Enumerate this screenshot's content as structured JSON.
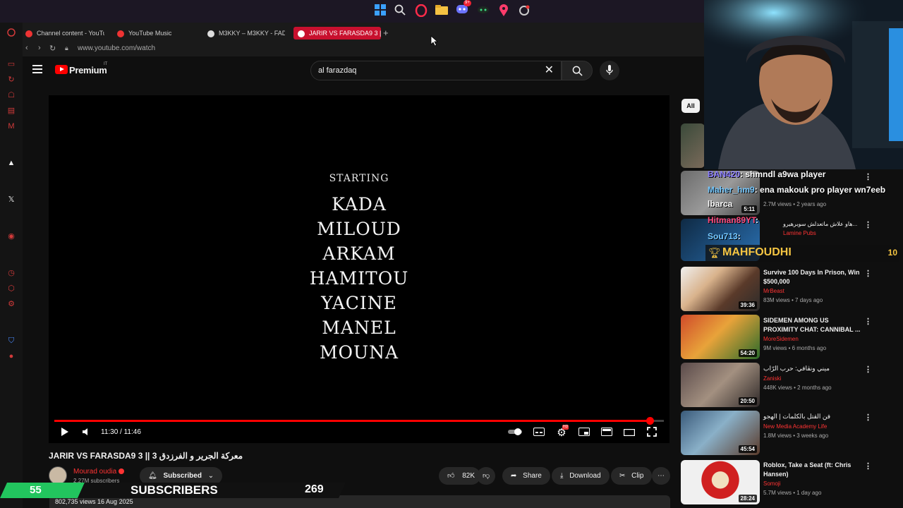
{
  "taskbar": {
    "icons": [
      "windows-start-icon",
      "search-icon",
      "opera-gx-icon",
      "file-explorer-icon",
      "discord-icon",
      "app-icon",
      "maps-icon",
      "settings-icon"
    ],
    "discord_badge": "9+"
  },
  "browser": {
    "tabs": [
      {
        "label": "Channel content - YouTu"
      },
      {
        "label": "YouTube Music"
      },
      {
        "label": "M3KKY – M3KKY - FADD"
      },
      {
        "label": "JARIR VS FARASDA9 3 ||"
      }
    ],
    "url": "www.youtube.com/watch"
  },
  "header": {
    "brand": "Premium",
    "country": "IT",
    "search_value": "al farazdaq"
  },
  "player": {
    "credits_heading": "STARTING",
    "credits_names": [
      "KADA",
      "MILOUD",
      "ARKAM",
      "HAMITOU",
      "YACINE",
      "MANEL",
      "MOUNA"
    ],
    "time": "11:30 / 11:46",
    "progress": 0.977,
    "settings_badge": "HD"
  },
  "video": {
    "title": "JARIR VS FARASDA9 3 || معركة الجرير و الفرزدق 3",
    "channel": "Mourad oudia",
    "subscribers": "2.27M subscribers",
    "subscribed_label": "Subscribed",
    "likes": "82K",
    "share_label": "Share",
    "download_label": "Download",
    "clip_label": "Clip",
    "views_date": "802,735 views  16 Aug 2025"
  },
  "sidebar": {
    "chip_all": "All",
    "recommendations": [
      {
        "title": "",
        "channel": "",
        "meta": "",
        "duration": ""
      },
      {
        "title": "",
        "channel": "",
        "meta": "2.7M views • 2 years ago",
        "duration": "5:11"
      },
      {
        "title": "هاو علاش ماتعدلش سوبرهيرو...",
        "channel": "Lamine Pubs",
        "meta": "",
        "duration": ""
      },
      {
        "title": "Survive 100 Days In Prison, Win $500,000",
        "channel": "MrBeast",
        "meta": "83M views • 7 days ago",
        "duration": "39:36"
      },
      {
        "title": "SIDEMEN AMONG US PROXIMITY CHAT: CANNIBAL ...",
        "channel": "MoreSidemen",
        "meta": "9M views • 6 months ago",
        "duration": "54:20"
      },
      {
        "title": "ميني ونڨافي: حرب الرّاب",
        "channel": "Zaniski",
        "meta": "448K views • 2 months ago",
        "duration": "20:50"
      },
      {
        "title": "فن القتل بالكلمات | الهجو",
        "channel": "New Media Academy Life",
        "meta": "1.8M views • 3 weeks ago",
        "duration": "45:54"
      },
      {
        "title": "Roblox, Take a Seat (ft: Chris Hansen)",
        "channel": "Somoji",
        "meta": "5.7M views • 1 day ago",
        "duration": "28:24"
      }
    ]
  },
  "chat": [
    {
      "user": "BAN420",
      "message": ": shmndl a9wa player"
    },
    {
      "user": "Maher_hm9",
      "message": ": ena makouk pro player wn7eeb"
    },
    {
      "user": "",
      "message": "lbarca"
    },
    {
      "user": "Hitman89YT",
      "message": ":"
    },
    {
      "user": "Sou713",
      "message": ":"
    }
  ],
  "goal": {
    "name": "MAHFOUDHI",
    "count": "10"
  },
  "subscriber_goal": {
    "current": "55",
    "label": "SUBSCRIBERS",
    "target": "269"
  },
  "colors": {
    "brand_red": "#ff0000",
    "tab_active": "#c8102e",
    "chat_user": "#8a7dff",
    "goal_green": "#22c55e"
  }
}
